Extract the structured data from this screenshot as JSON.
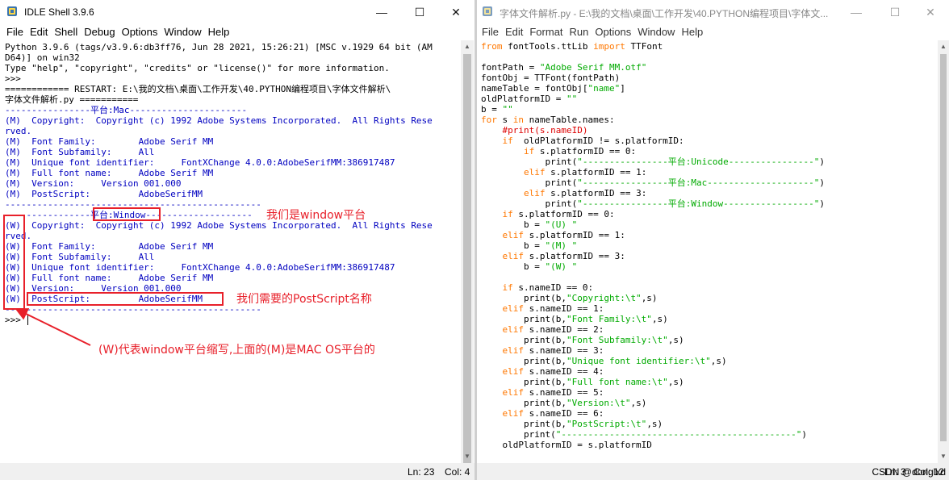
{
  "shell": {
    "title": "IDLE Shell 3.9.6",
    "controls": {
      "minimize": "—",
      "maximize": "☐",
      "close": "✕"
    },
    "menu": [
      "File",
      "Edit",
      "Shell",
      "Debug",
      "Options",
      "Window",
      "Help"
    ],
    "lines": [
      {
        "text": "Python 3.9.6 (tags/v3.9.6:db3ff76, Jun 28 2021, 15:26:21) [MSC v.1929 64 bit (AM",
        "style": "c-err"
      },
      {
        "text": "D64)] on win32",
        "style": "c-err"
      },
      {
        "text": "Type \"help\", \"copyright\", \"credits\" or \"license()\" for more information.",
        "style": "c-err"
      },
      {
        "text": ">>> ",
        "style": "c-err"
      },
      {
        "text": "============ RESTART: E:\\我的文档\\桌面\\工作开发\\40.PYTHON编程项目\\字体文件解析\\",
        "style": "c-err"
      },
      {
        "text": "字体文件解析.py ===========",
        "style": "c-err"
      },
      {
        "text": "----------------平台:Mac----------------------",
        "style": "c-out"
      },
      {
        "text": "(M)  Copyright:  Copyright (c) 1992 Adobe Systems Incorporated.  All Rights Rese",
        "style": "c-out"
      },
      {
        "text": "rved.",
        "style": "c-out"
      },
      {
        "text": "(M)  Font Family:        Adobe Serif MM",
        "style": "c-out"
      },
      {
        "text": "(M)  Font Subfamily:     All",
        "style": "c-out"
      },
      {
        "text": "(M)  Unique font identifier:     FontXChange 4.0.0:AdobeSerifMM:386917487",
        "style": "c-out"
      },
      {
        "text": "(M)  Full font name:     Adobe Serif MM",
        "style": "c-out"
      },
      {
        "text": "(M)  Version:     Version 001.000",
        "style": "c-out"
      },
      {
        "text": "(M)  PostScript:         AdobeSerifMM",
        "style": "c-out"
      },
      {
        "text": "------------------------------------------------",
        "style": "c-out"
      },
      {
        "text": "----------------平台:Window--------------------",
        "style": "c-out"
      },
      {
        "text": "(W)  Copyright:  Copyright (c) 1992 Adobe Systems Incorporated.  All Rights Rese",
        "style": "c-out"
      },
      {
        "text": "rved.",
        "style": "c-out"
      },
      {
        "text": "(W)  Font Family:        Adobe Serif MM",
        "style": "c-out"
      },
      {
        "text": "(W)  Font Subfamily:     All",
        "style": "c-out"
      },
      {
        "text": "(W)  Unique font identifier:     FontXChange 4.0.0:AdobeSerifMM:386917487",
        "style": "c-out"
      },
      {
        "text": "(W)  Full font name:     Adobe Serif MM",
        "style": "c-out"
      },
      {
        "text": "(W)  Version:     Version 001.000",
        "style": "c-out"
      },
      {
        "text": "(W)  PostScript:         AdobeSerifMM",
        "style": "c-out"
      },
      {
        "text": "------------------------------------------------",
        "style": "c-out"
      },
      {
        "text": ">>> ",
        "style": "c-err"
      }
    ],
    "status": {
      "ln": "Ln: 23",
      "col": "Col: 4"
    }
  },
  "annotations": {
    "window_platform": "我们是window平台",
    "postscript_name": "我们需要的PostScript名称",
    "w_meaning": "(W)代表window平台缩写,上面的(M)是MAC OS平台的",
    "color": "#e8202a"
  },
  "editor": {
    "title": "字体文件解析.py - E:\\我的文档\\桌面\\工作开发\\40.PYTHON编程项目\\字体文...",
    "controls": {
      "minimize": "—",
      "maximize": "☐",
      "close": "✕"
    },
    "menu": [
      "File",
      "Edit",
      "Format",
      "Run",
      "Options",
      "Window",
      "Help"
    ],
    "lines": [
      [
        {
          "t": "from",
          "s": "c-kw"
        },
        {
          "t": " fontTools.ttLib ",
          "s": ""
        },
        {
          "t": "import",
          "s": "c-kw"
        },
        {
          "t": " TTFont",
          "s": ""
        }
      ],
      [],
      [
        {
          "t": "fontPath = ",
          "s": ""
        },
        {
          "t": "\"Adobe Serif MM.otf\"",
          "s": "c-str"
        }
      ],
      [
        {
          "t": "fontObj = TTFont(fontPath)",
          "s": ""
        }
      ],
      [
        {
          "t": "nameTable = fontObj[",
          "s": ""
        },
        {
          "t": "\"name\"",
          "s": "c-str"
        },
        {
          "t": "]",
          "s": ""
        }
      ],
      [
        {
          "t": "oldPlatformID = ",
          "s": ""
        },
        {
          "t": "\"\"",
          "s": "c-str"
        }
      ],
      [
        {
          "t": "b = ",
          "s": ""
        },
        {
          "t": "\"\"",
          "s": "c-str"
        }
      ],
      [
        {
          "t": "for",
          "s": "c-kw"
        },
        {
          "t": " s ",
          "s": ""
        },
        {
          "t": "in",
          "s": "c-kw"
        },
        {
          "t": " nameTable.names:",
          "s": ""
        }
      ],
      [
        {
          "t": "    ",
          "s": ""
        },
        {
          "t": "#print(s.nameID)",
          "s": "c-com"
        }
      ],
      [
        {
          "t": "    ",
          "s": ""
        },
        {
          "t": "if",
          "s": "c-kw"
        },
        {
          "t": "  oldPlatformID != s.platformID:",
          "s": ""
        }
      ],
      [
        {
          "t": "        ",
          "s": ""
        },
        {
          "t": "if",
          "s": "c-kw"
        },
        {
          "t": " s.platformID == 0:",
          "s": ""
        }
      ],
      [
        {
          "t": "            print(",
          "s": ""
        },
        {
          "t": "\"----------------平台:Unicode----------------\"",
          "s": "c-str"
        },
        {
          "t": ")",
          "s": ""
        }
      ],
      [
        {
          "t": "        ",
          "s": ""
        },
        {
          "t": "elif",
          "s": "c-kw"
        },
        {
          "t": " s.platformID == 1:",
          "s": ""
        }
      ],
      [
        {
          "t": "            print(",
          "s": ""
        },
        {
          "t": "\"----------------平台:Mac--------------------\"",
          "s": "c-str"
        },
        {
          "t": ")",
          "s": ""
        }
      ],
      [
        {
          "t": "        ",
          "s": ""
        },
        {
          "t": "elif",
          "s": "c-kw"
        },
        {
          "t": " s.platformID == 3:",
          "s": ""
        }
      ],
      [
        {
          "t": "            print(",
          "s": ""
        },
        {
          "t": "\"----------------平台:Window-----------------\"",
          "s": "c-str"
        },
        {
          "t": ")",
          "s": ""
        }
      ],
      [
        {
          "t": "    ",
          "s": ""
        },
        {
          "t": "if",
          "s": "c-kw"
        },
        {
          "t": " s.platformID == 0:",
          "s": ""
        }
      ],
      [
        {
          "t": "        b = ",
          "s": ""
        },
        {
          "t": "\"(U) \"",
          "s": "c-str"
        }
      ],
      [
        {
          "t": "    ",
          "s": ""
        },
        {
          "t": "elif",
          "s": "c-kw"
        },
        {
          "t": " s.platformID == 1:",
          "s": ""
        }
      ],
      [
        {
          "t": "        b = ",
          "s": ""
        },
        {
          "t": "\"(M) \"",
          "s": "c-str"
        }
      ],
      [
        {
          "t": "    ",
          "s": ""
        },
        {
          "t": "elif",
          "s": "c-kw"
        },
        {
          "t": " s.platformID == 3:",
          "s": ""
        }
      ],
      [
        {
          "t": "        b = ",
          "s": ""
        },
        {
          "t": "\"(W) \"",
          "s": "c-str"
        }
      ],
      [],
      [
        {
          "t": "    ",
          "s": ""
        },
        {
          "t": "if",
          "s": "c-kw"
        },
        {
          "t": " s.nameID == 0:",
          "s": ""
        }
      ],
      [
        {
          "t": "        print(b,",
          "s": ""
        },
        {
          "t": "\"Copyright:\\t\"",
          "s": "c-str"
        },
        {
          "t": ",s)",
          "s": ""
        }
      ],
      [
        {
          "t": "    ",
          "s": ""
        },
        {
          "t": "elif",
          "s": "c-kw"
        },
        {
          "t": " s.nameID == 1:",
          "s": ""
        }
      ],
      [
        {
          "t": "        print(b,",
          "s": ""
        },
        {
          "t": "\"Font Family:\\t\"",
          "s": "c-str"
        },
        {
          "t": ",s)",
          "s": ""
        }
      ],
      [
        {
          "t": "    ",
          "s": ""
        },
        {
          "t": "elif",
          "s": "c-kw"
        },
        {
          "t": " s.nameID == 2:",
          "s": ""
        }
      ],
      [
        {
          "t": "        print(b,",
          "s": ""
        },
        {
          "t": "\"Font Subfamily:\\t\"",
          "s": "c-str"
        },
        {
          "t": ",s)",
          "s": ""
        }
      ],
      [
        {
          "t": "    ",
          "s": ""
        },
        {
          "t": "elif",
          "s": "c-kw"
        },
        {
          "t": " s.nameID == 3:",
          "s": ""
        }
      ],
      [
        {
          "t": "        print(b,",
          "s": ""
        },
        {
          "t": "\"Unique font identifier:\\t\"",
          "s": "c-str"
        },
        {
          "t": ",s)",
          "s": ""
        }
      ],
      [
        {
          "t": "    ",
          "s": ""
        },
        {
          "t": "elif",
          "s": "c-kw"
        },
        {
          "t": " s.nameID == 4:",
          "s": ""
        }
      ],
      [
        {
          "t": "        print(b,",
          "s": ""
        },
        {
          "t": "\"Full font name:\\t\"",
          "s": "c-str"
        },
        {
          "t": ",s)",
          "s": ""
        }
      ],
      [
        {
          "t": "    ",
          "s": ""
        },
        {
          "t": "elif",
          "s": "c-kw"
        },
        {
          "t": " s.nameID == 5:",
          "s": ""
        }
      ],
      [
        {
          "t": "        print(b,",
          "s": ""
        },
        {
          "t": "\"Version:\\t\"",
          "s": "c-str"
        },
        {
          "t": ",s)",
          "s": ""
        }
      ],
      [
        {
          "t": "    ",
          "s": ""
        },
        {
          "t": "elif",
          "s": "c-kw"
        },
        {
          "t": " s.nameID == 6:",
          "s": ""
        }
      ],
      [
        {
          "t": "        print(b,",
          "s": ""
        },
        {
          "t": "\"PostScript:\\t\"",
          "s": "c-str"
        },
        {
          "t": ",s)",
          "s": ""
        }
      ],
      [
        {
          "t": "        print(",
          "s": ""
        },
        {
          "t": "\"--------------------------------------------\"",
          "s": "c-str"
        },
        {
          "t": ")",
          "s": ""
        }
      ],
      [
        {
          "t": "    oldPlatformID = s.platformID",
          "s": ""
        }
      ]
    ],
    "status": {
      "ln": "Ln: 3",
      "col": "Col: 12"
    },
    "watermark": "CSDN @donglxd"
  }
}
